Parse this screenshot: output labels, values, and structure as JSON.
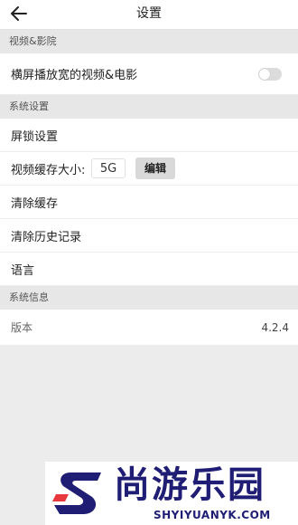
{
  "header": {
    "title": "设置",
    "back_icon": "arrow-left-icon"
  },
  "sections": {
    "video": {
      "header": "视频&影院",
      "landscape_label": "横屏播放宽的视频&电影",
      "landscape_toggle_on": false
    },
    "system": {
      "header": "系统设置",
      "screen_lock_label": "屏锁设置",
      "cache_size_label": "视频缓存大小:",
      "cache_size_value": "5G",
      "edit_label": "编辑",
      "clear_cache_label": "清除缓存",
      "clear_history_label": "清除历史记录",
      "language_label": "语言"
    },
    "info": {
      "header": "系统信息",
      "version_label": "版本",
      "version_value": "4.2.4"
    }
  },
  "watermark": {
    "title": "尚游乐园",
    "subtitle": "SHYIYUANYK.COM",
    "logo_icon": "s-logo-icon",
    "colors": {
      "navy": "#1f1d74",
      "red": "#e8383d"
    }
  },
  "colors": {
    "background": "#ececec",
    "section_header_bg": "#e7e7e7",
    "row_bg": "#ffffff",
    "toggle_off": "#dcdcdc",
    "button_bg": "#d9d9d9"
  }
}
